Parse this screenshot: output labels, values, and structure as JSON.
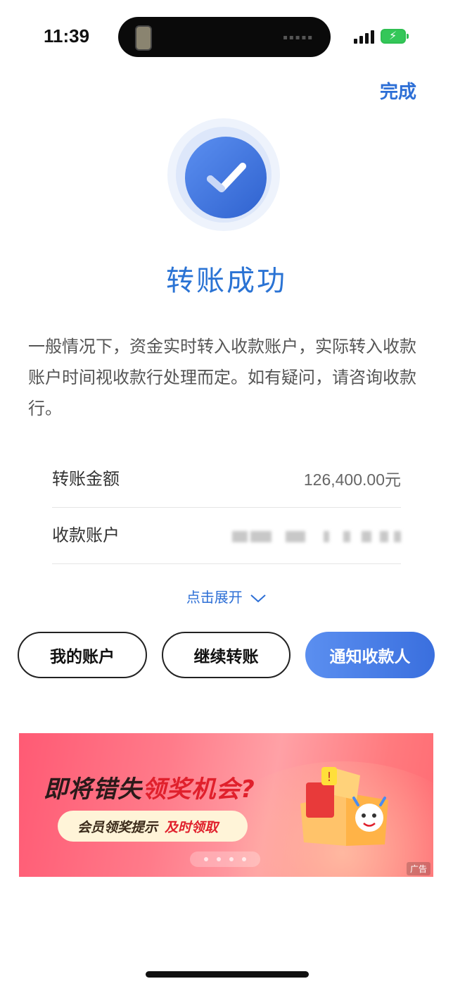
{
  "status_bar": {
    "time": "11:39"
  },
  "header": {
    "done_label": "完成"
  },
  "result": {
    "title": "转账成功",
    "description": "一般情况下，资金实时转入收款账户，实际转入收款账户时间视收款行处理而定。如有疑问，请咨询收款行。"
  },
  "details": [
    {
      "label": "转账金额",
      "value": "126,400.00元"
    },
    {
      "label": "收款账户",
      "value": ""
    }
  ],
  "expand_label": "点击展开",
  "actions": {
    "my_account": "我的账户",
    "continue_transfer": "继续转账",
    "notify_payee": "通知收款人"
  },
  "banner": {
    "headline_part1": "即将错失",
    "headline_part2": "领奖机会?",
    "pill_part1": "会员领奖提示",
    "pill_part2": "及时领取",
    "ad_label": "广告",
    "slides": 4
  },
  "colors": {
    "accent": "#2d6fd6",
    "title": "#2a73d4",
    "primary_button": "#4a80e8",
    "banner": "#ff6f80",
    "battery": "#34c759"
  }
}
